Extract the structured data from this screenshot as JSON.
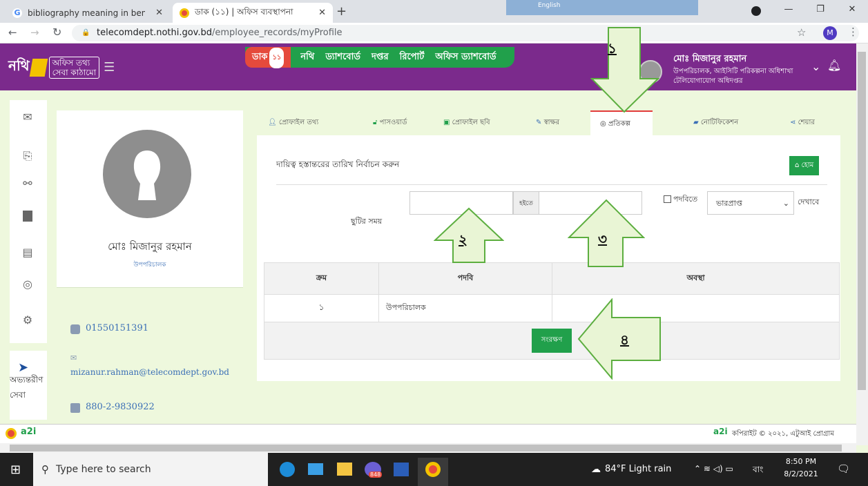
{
  "browser": {
    "tabs": [
      {
        "title": "bibliography meaning in bengali",
        "icon": "google-icon"
      },
      {
        "title": "ডাক (১১) | অফিস ব্যবস্থাপনা",
        "icon": "nothi-icon"
      }
    ],
    "new_tab": "+",
    "url_domain": "telecomdept.nothi.gov.bd",
    "url_path": "/employee_records/myProfile",
    "profile_initial": "M",
    "lang_overlay": "English"
  },
  "header": {
    "logo_text": "নথি",
    "logo_sub1": "অফিস তথ্য",
    "logo_sub2": "সেবা কাঠামো",
    "nav": [
      {
        "label": "ডাক",
        "badge": "১১"
      },
      {
        "label": "নথি"
      },
      {
        "label": "ড্যাশবোর্ড"
      },
      {
        "label": "দপ্তর"
      },
      {
        "label": "রিপোর্ট"
      },
      {
        "label": "অফিস ড্যাশবোর্ড"
      }
    ],
    "user_name": "মোঃ মিজানুর রহমান",
    "user_role": "উপপরিচালক, আইসিটি পরিকল্পনা অধিশাখা",
    "user_org": "টেলিযোগাযোগ অধিদপ্তর"
  },
  "sidebar": {
    "icons": [
      "envelope-icon",
      "files-icon",
      "binoculars-icon",
      "book-icon",
      "clipboard-icon",
      "help-icon",
      "settings-icon"
    ],
    "internal_label_1": "অভ্যন্তরীণ",
    "internal_label_2": "সেবা"
  },
  "profile": {
    "name": "মোঃ মিজানুর রহমান",
    "designation": "উপপরিচালক",
    "phone": "01550151391",
    "email": "mizanur.rahman@telecomdept.gov.bd",
    "fax": "880-2-9830922"
  },
  "tabs": [
    {
      "label": "প্রোফাইল তথ্য",
      "icon": "user-icon"
    },
    {
      "label": "পাসওয়ার্ড",
      "icon": "unlock-icon"
    },
    {
      "label": "প্রোফাইল ছবি",
      "icon": "image-icon"
    },
    {
      "label": "স্বাক্ষর",
      "icon": "signature-icon"
    },
    {
      "label": "প্রতিকল্প",
      "icon": "target-icon"
    },
    {
      "label": "নোটিফিকেশন",
      "icon": "notification-icon"
    },
    {
      "label": "শেয়ার",
      "icon": "share-icon"
    }
  ],
  "panel": {
    "heading": "দায়িত্ব হস্তান্তরের তারিখ নির্বাচন করুন",
    "home_button": "হোম",
    "leave_label": "ছুটির সময়",
    "from_label": "হইতে",
    "checkbox_label": "পদবিতে",
    "select_value": "ভারপ্রাপ্ত",
    "show_label": "দেখাবে",
    "table_headers": [
      "ক্রম",
      "পদবি",
      "অবস্থা"
    ],
    "rows": [
      [
        "১",
        "উপপরিচালক",
        ""
      ]
    ],
    "save_button": "সংরক্ষণ"
  },
  "annotations": [
    "১",
    "২",
    "৩",
    "৪"
  ],
  "footer": {
    "copyright": "কপিরাইট © ২০২১, এটুআই প্রোগ্রাম"
  },
  "taskbar": {
    "search_placeholder": "Type here to search",
    "weather": "84°F  Light rain",
    "lang": "বাং",
    "time": "8:50 PM",
    "date": "8/2/2021",
    "badge": "848"
  },
  "colors": {
    "header": "#7b2a8c",
    "nav_green": "#21a04b",
    "dak_red": "#e54a3c",
    "page_bg": "#eef8dd",
    "active_tab_border": "#e23b3b",
    "arrow_fill": "#e9f5d5",
    "arrow_stroke": "#5cae3f"
  }
}
